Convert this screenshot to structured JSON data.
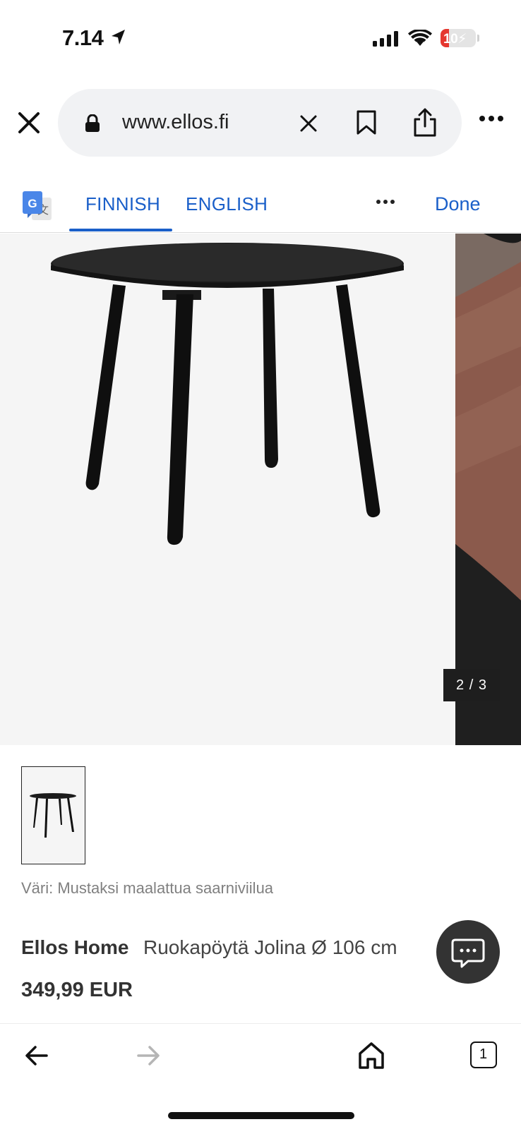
{
  "status_bar": {
    "time": "7.14",
    "battery": "10",
    "icons": [
      "location-arrow-icon",
      "cellular-signal-icon",
      "wifi-icon",
      "battery-icon"
    ]
  },
  "browser": {
    "url": "www.ellos.fi",
    "icons": [
      "close-icon",
      "lock-icon",
      "clear-icon",
      "bookmark-icon",
      "share-icon",
      "more-icon"
    ]
  },
  "translate": {
    "languages": [
      "FINNISH",
      "ENGLISH"
    ],
    "active_language": "FINNISH",
    "done_label": "Done",
    "accent_color": "#1a5fc9"
  },
  "gallery": {
    "counter": "2 / 3"
  },
  "product": {
    "color_label": "Väri: Mustaksi maalattua saarniviilua",
    "brand": "Ellos Home",
    "name": "Ruokapöytä Jolina Ø 106 cm",
    "price": "349,99 EUR"
  },
  "toolbar": {
    "tab_count": "1",
    "icons": [
      "back-arrow-icon",
      "forward-arrow-icon",
      "home-icon",
      "tabs-icon"
    ]
  }
}
